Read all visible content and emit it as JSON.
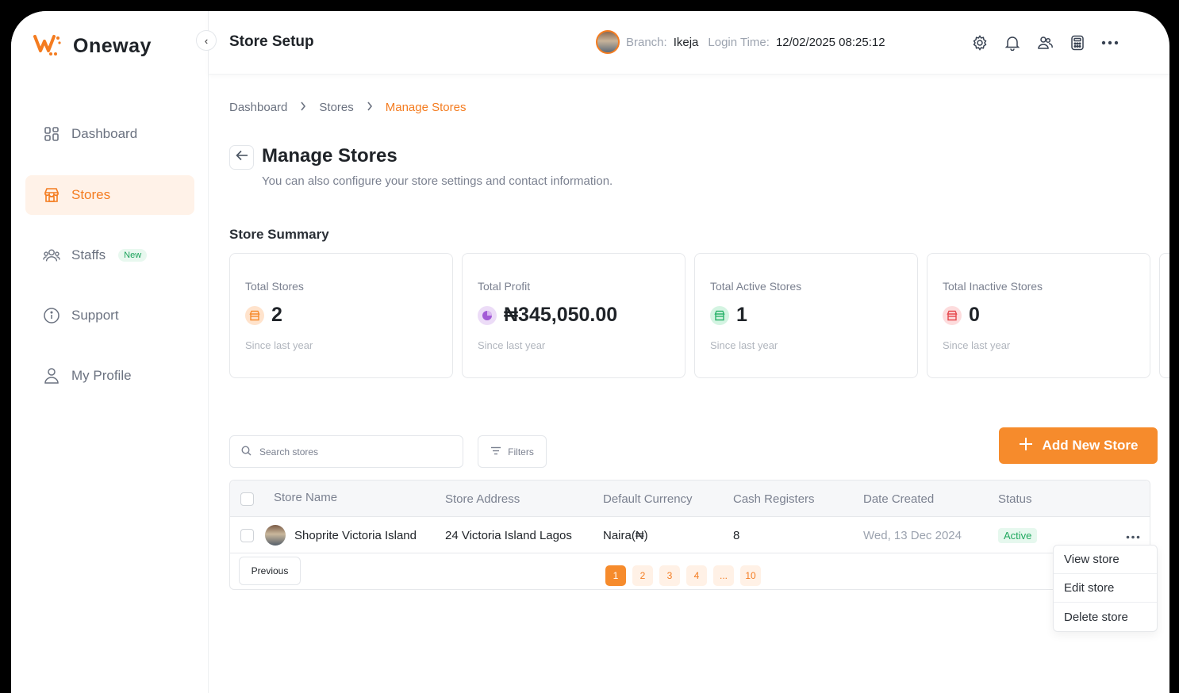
{
  "app": {
    "name": "Oneway",
    "brand_color": "#f47c20"
  },
  "header": {
    "title": "Store Setup",
    "branch_label": "Branch:",
    "branch_value": "Ikeja",
    "login_label": "Login Time:",
    "login_value": "12/02/2025 08:25:12",
    "icons": [
      "settings-icon",
      "bell-icon",
      "users-icon",
      "calculator-icon",
      "more-icon"
    ]
  },
  "sidebar": {
    "items": [
      {
        "label": "Dashboard",
        "icon": "grid-icon",
        "active": false
      },
      {
        "label": "Stores",
        "icon": "store-icon",
        "active": true
      },
      {
        "label": "Staffs",
        "icon": "team-icon",
        "active": false,
        "badge": "New"
      },
      {
        "label": "Support",
        "icon": "info-icon",
        "active": false
      },
      {
        "label": "My Profile",
        "icon": "user-icon",
        "active": false
      }
    ]
  },
  "breadcrumb": [
    "Dashboard",
    "Stores",
    "Manage Stores"
  ],
  "page": {
    "title": "Manage Stores",
    "subtitle": "You can also configure your store settings and contact information."
  },
  "summary": {
    "title": "Store Summary",
    "cards": [
      {
        "label": "Total Stores",
        "value": "2",
        "foot": "Since last year",
        "color": "#f68b2c"
      },
      {
        "label": "Total Profit",
        "value": "₦345,050.00",
        "foot": "Since last year",
        "color": "#a35bd6"
      },
      {
        "label": "Total Active Stores",
        "value": "1",
        "foot": "Since last year",
        "color": "#2bb36b"
      },
      {
        "label": "Total Inactive Stores",
        "value": "0",
        "foot": "Since last year",
        "color": "#e5484d"
      }
    ]
  },
  "toolbar": {
    "search_placeholder": "Search stores",
    "filters_label": "Filters",
    "add_label": "Add New Store"
  },
  "table": {
    "columns": [
      "Store Name",
      "Store Address",
      "Default Currency",
      "Cash Registers",
      "Date Created",
      "Status"
    ],
    "rows": [
      {
        "name": "Shoprite Victoria Island",
        "address": "24 Victoria Island Lagos",
        "currency": "Naira(₦)",
        "registers": "8",
        "date": "Wed, 13 Dec 2024",
        "status": "Active"
      }
    ],
    "previous_label": "Previous",
    "pages": [
      "1",
      "2",
      "3",
      "4",
      "...",
      "10"
    ],
    "current_page": "1"
  },
  "row_menu": [
    "View store",
    "Edit store",
    "Delete store"
  ]
}
